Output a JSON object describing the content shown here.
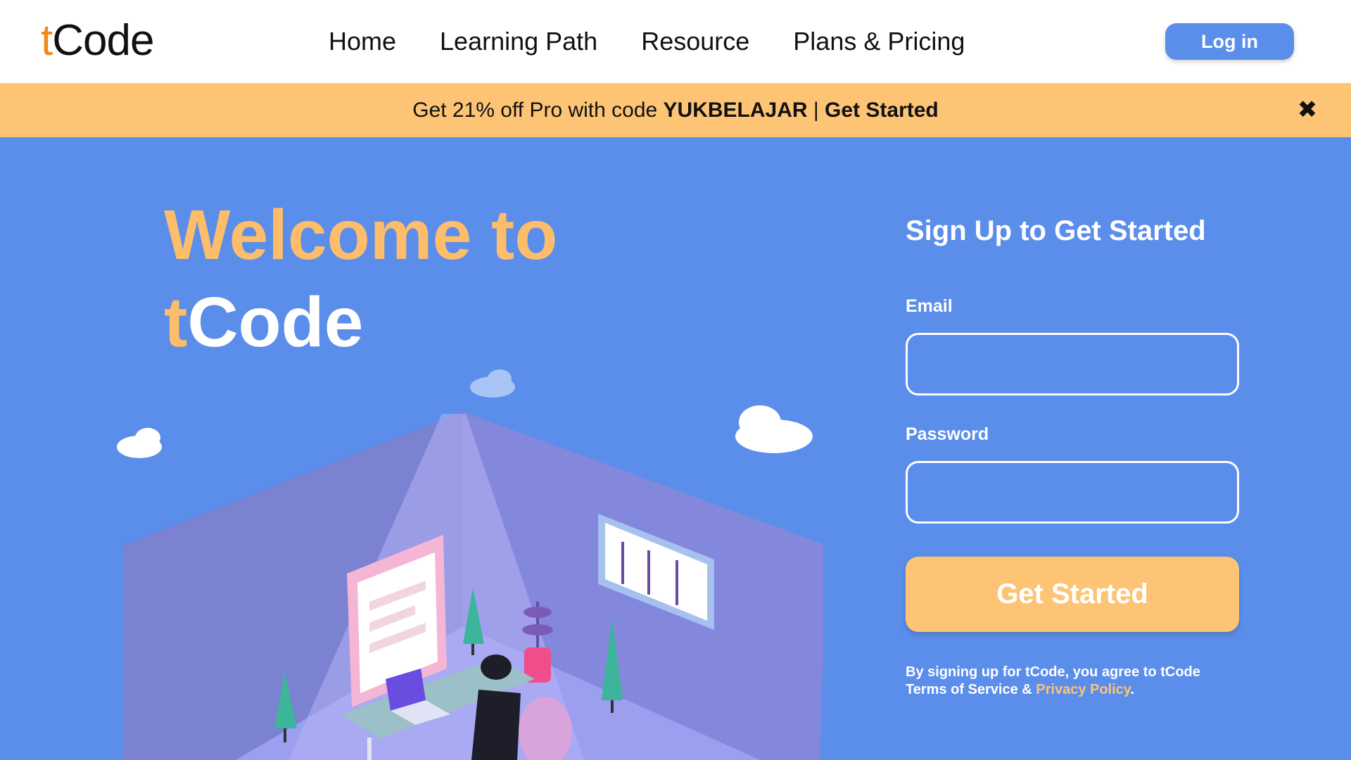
{
  "nav": {
    "logo_t": "t",
    "logo_rest": "Code",
    "links": [
      {
        "label": "Home"
      },
      {
        "label": "Learning Path"
      },
      {
        "label": "Resource"
      },
      {
        "label": "Plans & Pricing"
      }
    ],
    "login_label": "Log in"
  },
  "promo": {
    "text_before": "Get 21% off Pro with code ",
    "code": "YUKBELAJAR",
    "separator": " | ",
    "cta": "Get Started",
    "close_glyph": "✖"
  },
  "hero": {
    "line1": "Welcome to",
    "line2_t": "t",
    "line2_rest": "Code"
  },
  "signup": {
    "title": "Sign Up to Get Started",
    "email_label": "Email",
    "email_value": "",
    "password_label": "Password",
    "password_value": "",
    "submit_label": "Get Started",
    "terms_text": "By signing up for tCode, you agree to tCode Terms of Service & ",
    "privacy_link": "Privacy Policy",
    "terms_end": "."
  },
  "colors": {
    "brand_blue": "#5b8dea",
    "accent_orange": "#fdc476",
    "logo_orange": "#f08a1a"
  },
  "icons": [
    "close-icon",
    "cloud-icon",
    "plant-icon",
    "laptop-icon"
  ]
}
